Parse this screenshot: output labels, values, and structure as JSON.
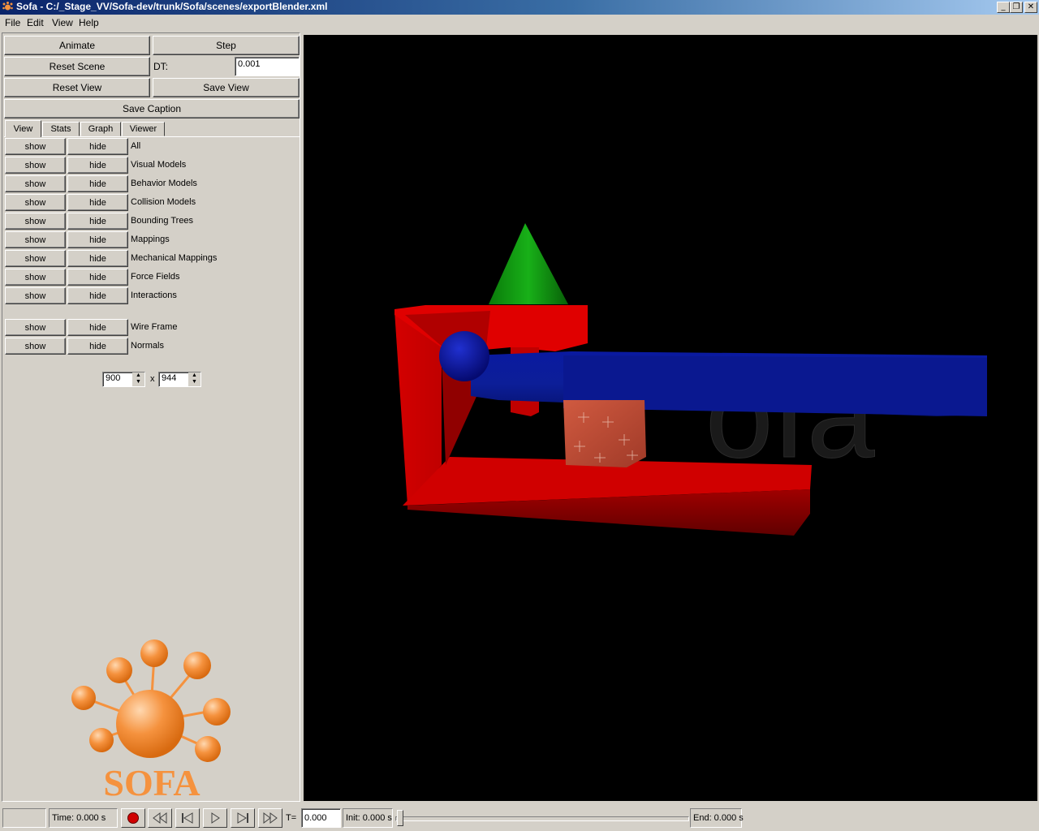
{
  "window": {
    "title": "Sofa - C:/_Stage_VV/Sofa-dev/trunk/Sofa/scenes/exportBlender.xml",
    "minimize_glyph": "_",
    "restore_glyph": "❐",
    "close_glyph": "✕"
  },
  "menu": [
    "File",
    "Edit",
    "View",
    "Help"
  ],
  "controls": {
    "animate": "Animate",
    "step": "Step",
    "reset_scene": "Reset Scene",
    "dt_label": "DT:",
    "dt_value": "0.001",
    "reset_view": "Reset View",
    "save_view": "Save View",
    "save_caption": "Save Caption"
  },
  "tabs": [
    "View",
    "Stats",
    "Graph",
    "Viewer"
  ],
  "view_rows": [
    {
      "show": "show",
      "hide": "hide",
      "label": "All"
    },
    {
      "show": "show",
      "hide": "hide",
      "label": "Visual Models"
    },
    {
      "show": "show",
      "hide": "hide",
      "label": "Behavior Models"
    },
    {
      "show": "show",
      "hide": "hide",
      "label": "Collision Models"
    },
    {
      "show": "show",
      "hide": "hide",
      "label": "Bounding Trees"
    },
    {
      "show": "show",
      "hide": "hide",
      "label": "Mappings"
    },
    {
      "show": "show",
      "hide": "hide",
      "label": "Mechanical Mappings"
    },
    {
      "show": "show",
      "hide": "hide",
      "label": "Force Fields"
    },
    {
      "show": "show",
      "hide": "hide",
      "label": "Interactions"
    }
  ],
  "extra_rows": [
    {
      "show": "show",
      "hide": "hide",
      "label": "Wire Frame"
    },
    {
      "show": "show",
      "hide": "hide",
      "label": "Normals"
    }
  ],
  "size": {
    "width": "900",
    "x": "x",
    "height": "944"
  },
  "logo_text": "SOFA",
  "watermark_text": "ofa",
  "bottom": {
    "time": "Time: 0.000 s",
    "t_label": "T=",
    "t_value": "0.000",
    "init": "Init: 0.000 s",
    "end": "End: 0.000 s",
    "slider_position": 0
  },
  "icons": {
    "record": "record-icon",
    "rewind": "fast-backward-icon",
    "step_back": "step-backward-icon",
    "play": "play-icon",
    "step_forward": "step-forward-icon",
    "fast_forward": "fast-forward-icon"
  },
  "colors": {
    "titlebar": "#0a246a",
    "panel": "#d4d0c8",
    "viewer_bg": "#000000",
    "logo_orange": "#f5923e",
    "scene_red": "#e00000",
    "scene_blue": "#0a1aa0",
    "scene_green": "#10a010"
  }
}
